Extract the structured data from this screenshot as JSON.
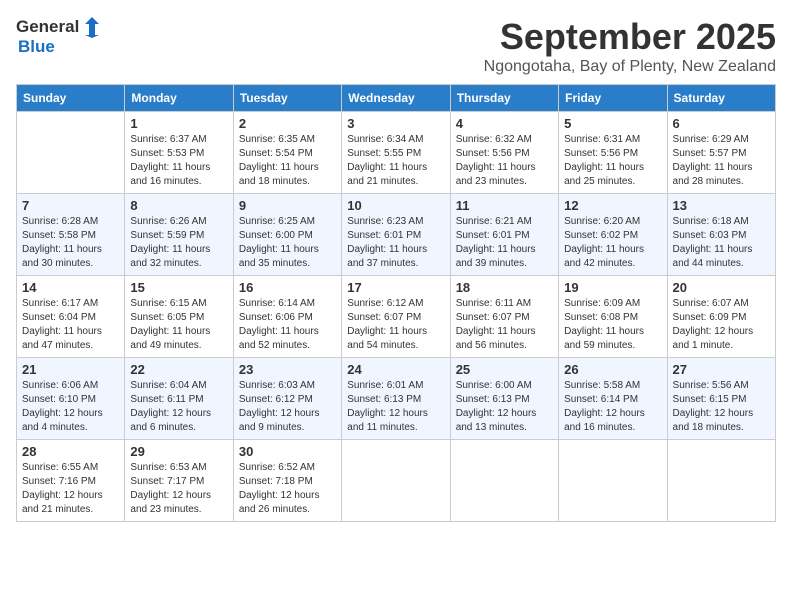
{
  "logo": {
    "general": "General",
    "blue": "Blue"
  },
  "header": {
    "month": "September 2025",
    "location": "Ngongotaha, Bay of Plenty, New Zealand"
  },
  "days_of_week": [
    "Sunday",
    "Monday",
    "Tuesday",
    "Wednesday",
    "Thursday",
    "Friday",
    "Saturday"
  ],
  "weeks": [
    [
      {
        "day": "",
        "sunrise": "",
        "sunset": "",
        "daylight": ""
      },
      {
        "day": "1",
        "sunrise": "Sunrise: 6:37 AM",
        "sunset": "Sunset: 5:53 PM",
        "daylight": "Daylight: 11 hours and 16 minutes."
      },
      {
        "day": "2",
        "sunrise": "Sunrise: 6:35 AM",
        "sunset": "Sunset: 5:54 PM",
        "daylight": "Daylight: 11 hours and 18 minutes."
      },
      {
        "day": "3",
        "sunrise": "Sunrise: 6:34 AM",
        "sunset": "Sunset: 5:55 PM",
        "daylight": "Daylight: 11 hours and 21 minutes."
      },
      {
        "day": "4",
        "sunrise": "Sunrise: 6:32 AM",
        "sunset": "Sunset: 5:56 PM",
        "daylight": "Daylight: 11 hours and 23 minutes."
      },
      {
        "day": "5",
        "sunrise": "Sunrise: 6:31 AM",
        "sunset": "Sunset: 5:56 PM",
        "daylight": "Daylight: 11 hours and 25 minutes."
      },
      {
        "day": "6",
        "sunrise": "Sunrise: 6:29 AM",
        "sunset": "Sunset: 5:57 PM",
        "daylight": "Daylight: 11 hours and 28 minutes."
      }
    ],
    [
      {
        "day": "7",
        "sunrise": "Sunrise: 6:28 AM",
        "sunset": "Sunset: 5:58 PM",
        "daylight": "Daylight: 11 hours and 30 minutes."
      },
      {
        "day": "8",
        "sunrise": "Sunrise: 6:26 AM",
        "sunset": "Sunset: 5:59 PM",
        "daylight": "Daylight: 11 hours and 32 minutes."
      },
      {
        "day": "9",
        "sunrise": "Sunrise: 6:25 AM",
        "sunset": "Sunset: 6:00 PM",
        "daylight": "Daylight: 11 hours and 35 minutes."
      },
      {
        "day": "10",
        "sunrise": "Sunrise: 6:23 AM",
        "sunset": "Sunset: 6:01 PM",
        "daylight": "Daylight: 11 hours and 37 minutes."
      },
      {
        "day": "11",
        "sunrise": "Sunrise: 6:21 AM",
        "sunset": "Sunset: 6:01 PM",
        "daylight": "Daylight: 11 hours and 39 minutes."
      },
      {
        "day": "12",
        "sunrise": "Sunrise: 6:20 AM",
        "sunset": "Sunset: 6:02 PM",
        "daylight": "Daylight: 11 hours and 42 minutes."
      },
      {
        "day": "13",
        "sunrise": "Sunrise: 6:18 AM",
        "sunset": "Sunset: 6:03 PM",
        "daylight": "Daylight: 11 hours and 44 minutes."
      }
    ],
    [
      {
        "day": "14",
        "sunrise": "Sunrise: 6:17 AM",
        "sunset": "Sunset: 6:04 PM",
        "daylight": "Daylight: 11 hours and 47 minutes."
      },
      {
        "day": "15",
        "sunrise": "Sunrise: 6:15 AM",
        "sunset": "Sunset: 6:05 PM",
        "daylight": "Daylight: 11 hours and 49 minutes."
      },
      {
        "day": "16",
        "sunrise": "Sunrise: 6:14 AM",
        "sunset": "Sunset: 6:06 PM",
        "daylight": "Daylight: 11 hours and 52 minutes."
      },
      {
        "day": "17",
        "sunrise": "Sunrise: 6:12 AM",
        "sunset": "Sunset: 6:07 PM",
        "daylight": "Daylight: 11 hours and 54 minutes."
      },
      {
        "day": "18",
        "sunrise": "Sunrise: 6:11 AM",
        "sunset": "Sunset: 6:07 PM",
        "daylight": "Daylight: 11 hours and 56 minutes."
      },
      {
        "day": "19",
        "sunrise": "Sunrise: 6:09 AM",
        "sunset": "Sunset: 6:08 PM",
        "daylight": "Daylight: 11 hours and 59 minutes."
      },
      {
        "day": "20",
        "sunrise": "Sunrise: 6:07 AM",
        "sunset": "Sunset: 6:09 PM",
        "daylight": "Daylight: 12 hours and 1 minute."
      }
    ],
    [
      {
        "day": "21",
        "sunrise": "Sunrise: 6:06 AM",
        "sunset": "Sunset: 6:10 PM",
        "daylight": "Daylight: 12 hours and 4 minutes."
      },
      {
        "day": "22",
        "sunrise": "Sunrise: 6:04 AM",
        "sunset": "Sunset: 6:11 PM",
        "daylight": "Daylight: 12 hours and 6 minutes."
      },
      {
        "day": "23",
        "sunrise": "Sunrise: 6:03 AM",
        "sunset": "Sunset: 6:12 PM",
        "daylight": "Daylight: 12 hours and 9 minutes."
      },
      {
        "day": "24",
        "sunrise": "Sunrise: 6:01 AM",
        "sunset": "Sunset: 6:13 PM",
        "daylight": "Daylight: 12 hours and 11 minutes."
      },
      {
        "day": "25",
        "sunrise": "Sunrise: 6:00 AM",
        "sunset": "Sunset: 6:13 PM",
        "daylight": "Daylight: 12 hours and 13 minutes."
      },
      {
        "day": "26",
        "sunrise": "Sunrise: 5:58 AM",
        "sunset": "Sunset: 6:14 PM",
        "daylight": "Daylight: 12 hours and 16 minutes."
      },
      {
        "day": "27",
        "sunrise": "Sunrise: 5:56 AM",
        "sunset": "Sunset: 6:15 PM",
        "daylight": "Daylight: 12 hours and 18 minutes."
      }
    ],
    [
      {
        "day": "28",
        "sunrise": "Sunrise: 6:55 AM",
        "sunset": "Sunset: 7:16 PM",
        "daylight": "Daylight: 12 hours and 21 minutes."
      },
      {
        "day": "29",
        "sunrise": "Sunrise: 6:53 AM",
        "sunset": "Sunset: 7:17 PM",
        "daylight": "Daylight: 12 hours and 23 minutes."
      },
      {
        "day": "30",
        "sunrise": "Sunrise: 6:52 AM",
        "sunset": "Sunset: 7:18 PM",
        "daylight": "Daylight: 12 hours and 26 minutes."
      },
      {
        "day": "",
        "sunrise": "",
        "sunset": "",
        "daylight": ""
      },
      {
        "day": "",
        "sunrise": "",
        "sunset": "",
        "daylight": ""
      },
      {
        "day": "",
        "sunrise": "",
        "sunset": "",
        "daylight": ""
      },
      {
        "day": "",
        "sunrise": "",
        "sunset": "",
        "daylight": ""
      }
    ]
  ]
}
